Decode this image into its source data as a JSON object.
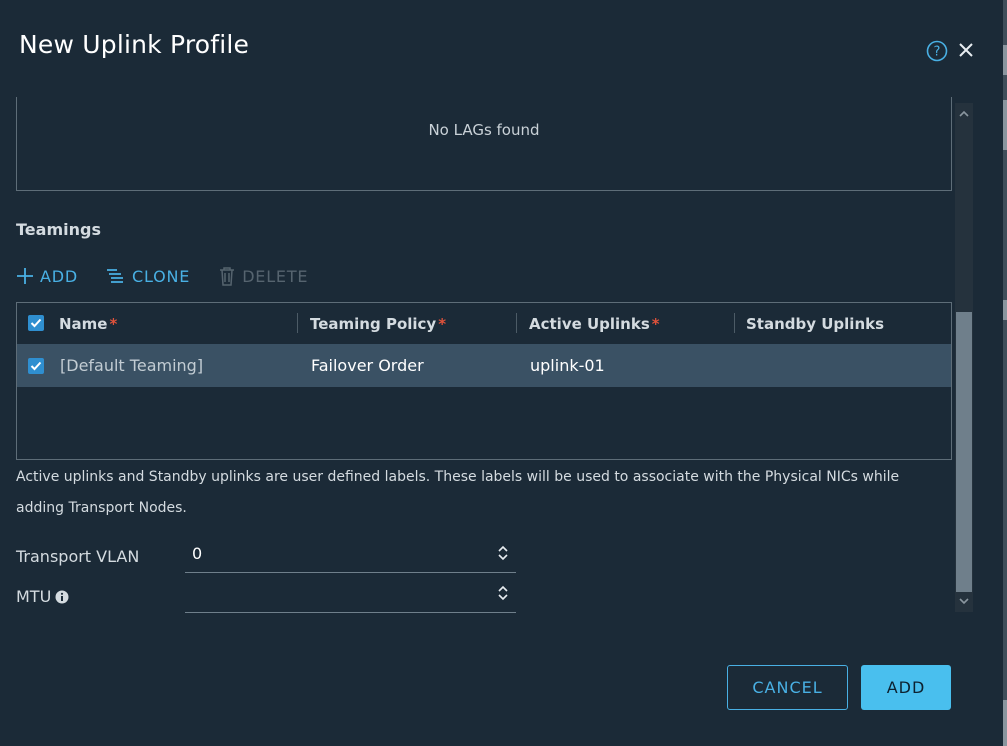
{
  "dialog": {
    "title": "New Uplink Profile"
  },
  "lags": {
    "empty_text": "No LAGs found"
  },
  "teamings": {
    "title": "Teamings",
    "actions": {
      "add": "ADD",
      "clone": "CLONE",
      "delete": "DELETE"
    },
    "columns": [
      {
        "label": "Name",
        "required": "*"
      },
      {
        "label": "Teaming Policy",
        "required": "*"
      },
      {
        "label": "Active Uplinks",
        "required": "*"
      },
      {
        "label": "Standby Uplinks",
        "required": ""
      }
    ],
    "rows": [
      {
        "name": "[Default Teaming]",
        "policy": "Failover Order",
        "active": "uplink-01",
        "standby": ""
      }
    ]
  },
  "hint": "Active uplinks and Standby uplinks are user defined labels. These labels will be used to associate with the Physical NICs while adding Transport Nodes.",
  "fields": {
    "transport_vlan": {
      "label": "Transport VLAN",
      "value": "0"
    },
    "mtu": {
      "label": "MTU",
      "value": ""
    }
  },
  "footer": {
    "cancel": "CANCEL",
    "add": "ADD"
  },
  "colors": {
    "background": "#1b2a37",
    "accent": "#49b0e4",
    "primary_button": "#49bfee",
    "selected_row": "#3a5164",
    "required": "#e0523b"
  }
}
